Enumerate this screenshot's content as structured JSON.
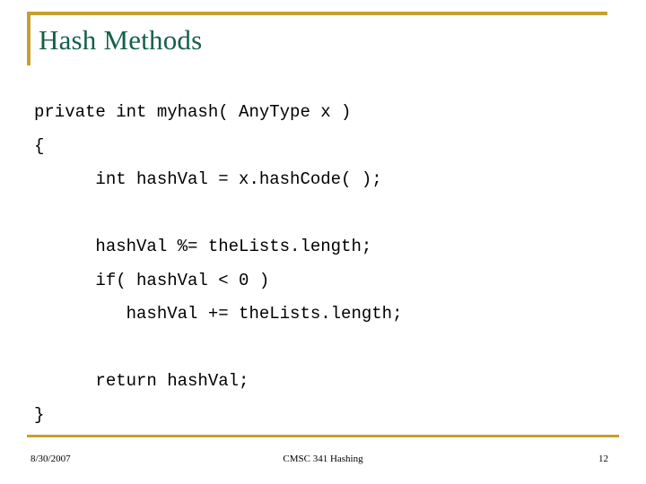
{
  "slide": {
    "title": "Hash Methods",
    "accent_color": "#c5a02e",
    "title_color": "#14604a",
    "background_color": "#ffffff",
    "code_color": "#000000"
  },
  "code": {
    "lines": [
      {
        "text": "private int myhash( AnyType x )",
        "indent": 0
      },
      {
        "text": "{",
        "indent": 0
      },
      {
        "text": "int hashVal = x.hashCode( );",
        "indent": 6
      },
      {
        "text": "",
        "indent": 0
      },
      {
        "text": "hashVal %= theLists.length;",
        "indent": 6
      },
      {
        "text": "if( hashVal < 0 )",
        "indent": 6
      },
      {
        "text": "hashVal += theLists.length;",
        "indent": 9
      },
      {
        "text": "",
        "indent": 0
      },
      {
        "text": "return hashVal;",
        "indent": 6
      },
      {
        "text": "}",
        "indent": 0
      }
    ]
  },
  "footer": {
    "date": "8/30/2007",
    "center": "CMSC 341 Hashing",
    "page_number": "12"
  }
}
